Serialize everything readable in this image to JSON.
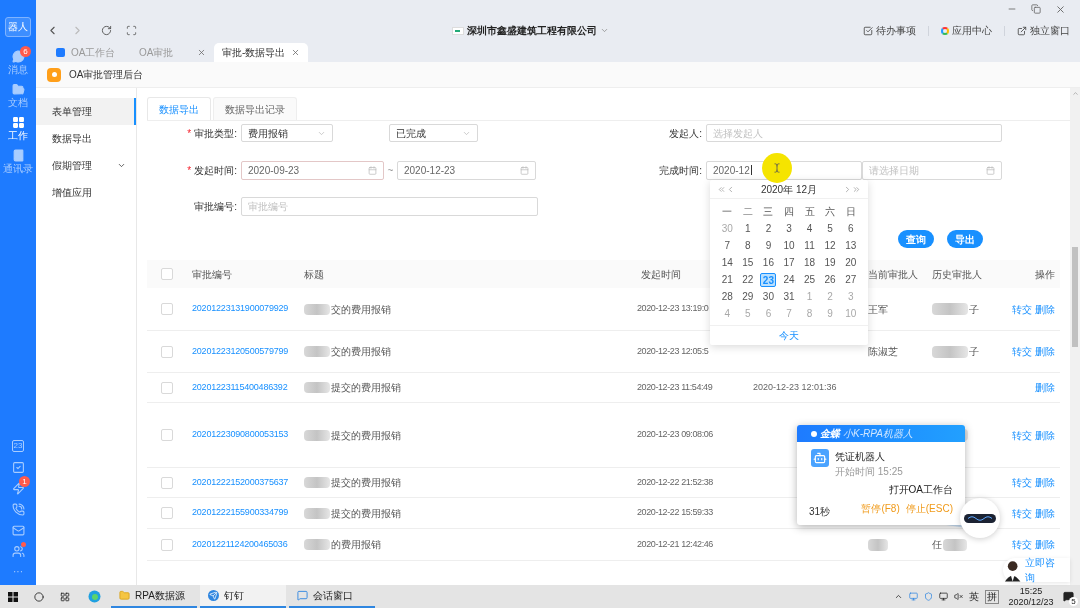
{
  "rail": {
    "logo": "器人",
    "items": [
      {
        "label": "消息",
        "kind": "chat",
        "badge": "6",
        "selected": false
      },
      {
        "label": "文档",
        "kind": "docs",
        "selected": false
      },
      {
        "label": "工作",
        "kind": "work",
        "selected": true
      },
      {
        "label": "通讯录",
        "kind": "contacts",
        "selected": false
      }
    ],
    "bottom": [
      {
        "kind": "calendar",
        "label": "23",
        "dot": false
      },
      {
        "kind": "todo",
        "dot": false
      },
      {
        "kind": "ding",
        "badge": "1",
        "dot": false
      },
      {
        "kind": "phone",
        "dot": false
      },
      {
        "kind": "mail",
        "dot": false
      },
      {
        "kind": "team",
        "dot": true
      },
      {
        "kind": "more",
        "label": "···",
        "dot": false
      }
    ]
  },
  "toolbar": {
    "company": "深圳市鑫盛建筑工程有限公司",
    "actions": [
      {
        "label": "待办事项",
        "kind": "todo"
      },
      {
        "label": "应用中心",
        "kind": "apps"
      },
      {
        "label": "独立窗口",
        "kind": "window"
      }
    ]
  },
  "tabs": [
    {
      "label": "OA工作台",
      "kind": "app",
      "closable": false,
      "selected": false
    },
    {
      "label": "OA审批",
      "kind": "page",
      "closable": true,
      "selected": false
    },
    {
      "label": "审批-数据导出",
      "kind": "page",
      "closable": true,
      "selected": true
    }
  ],
  "app_header": {
    "title": "OA审批管理后台"
  },
  "menu": [
    {
      "label": "表单管理",
      "expandable": false,
      "selected": true
    },
    {
      "label": "数据导出",
      "expandable": false,
      "selected": false
    },
    {
      "label": "假期管理",
      "expandable": true,
      "selected": false
    },
    {
      "label": "增值应用",
      "expandable": false,
      "selected": false
    }
  ],
  "content_tabs": [
    {
      "label": "数据导出",
      "selected": true
    },
    {
      "label": "数据导出记录",
      "selected": false
    }
  ],
  "form": {
    "approval_type": {
      "mark": "*",
      "label": "审批类型:",
      "value": "费用报销"
    },
    "status": {
      "value": "已完成"
    },
    "initiator": {
      "label": "发起人:",
      "placeholder": "选择发起人"
    },
    "start_time": {
      "mark": "*",
      "label": "发起时间:",
      "from": "2020-09-23",
      "separator": "~",
      "to": "2020-12-23"
    },
    "finish_time": {
      "label": "完成时间:",
      "from": "2020-12",
      "to_placeholder": "请选择日期"
    },
    "approval_no": {
      "label": "审批编号:",
      "placeholder": "审批编号"
    },
    "buttons": [
      "查询",
      "导出"
    ]
  },
  "calendar": {
    "title": "2020年 12月",
    "weekdays": [
      "一",
      "二",
      "三",
      "四",
      "五",
      "六",
      "日"
    ],
    "days": [
      {
        "label": "30",
        "outside": true,
        "selected": false
      },
      {
        "label": "1",
        "outside": false,
        "selected": false
      },
      {
        "label": "2",
        "outside": false,
        "selected": false
      },
      {
        "label": "3",
        "outside": false,
        "selected": false
      },
      {
        "label": "4",
        "outside": false,
        "selected": false
      },
      {
        "label": "5",
        "outside": false,
        "selected": false
      },
      {
        "label": "6",
        "outside": false,
        "selected": false
      },
      {
        "label": "7",
        "outside": false,
        "selected": false
      },
      {
        "label": "8",
        "outside": false,
        "selected": false
      },
      {
        "label": "9",
        "outside": false,
        "selected": false
      },
      {
        "label": "10",
        "outside": false,
        "selected": false
      },
      {
        "label": "11",
        "outside": false,
        "selected": false
      },
      {
        "label": "12",
        "outside": false,
        "selected": false
      },
      {
        "label": "13",
        "outside": false,
        "selected": false
      },
      {
        "label": "14",
        "outside": false,
        "selected": false
      },
      {
        "label": "15",
        "outside": false,
        "selected": false
      },
      {
        "label": "16",
        "outside": false,
        "selected": false
      },
      {
        "label": "17",
        "outside": false,
        "selected": false
      },
      {
        "label": "18",
        "outside": false,
        "selected": false
      },
      {
        "label": "19",
        "outside": false,
        "selected": false
      },
      {
        "label": "20",
        "outside": false,
        "selected": false
      },
      {
        "label": "21",
        "outside": false,
        "selected": false
      },
      {
        "label": "22",
        "outside": false,
        "selected": false
      },
      {
        "label": "23",
        "outside": false,
        "selected": true
      },
      {
        "label": "24",
        "outside": false,
        "selected": false
      },
      {
        "label": "25",
        "outside": false,
        "selected": false
      },
      {
        "label": "26",
        "outside": false,
        "selected": false
      },
      {
        "label": "27",
        "outside": false,
        "selected": false
      },
      {
        "label": "28",
        "outside": false,
        "selected": false
      },
      {
        "label": "29",
        "outside": false,
        "selected": false
      },
      {
        "label": "30",
        "outside": false,
        "selected": false
      },
      {
        "label": "31",
        "outside": false,
        "selected": false
      },
      {
        "label": "1",
        "outside": true,
        "selected": false
      },
      {
        "label": "2",
        "outside": true,
        "selected": false
      },
      {
        "label": "3",
        "outside": true,
        "selected": false
      },
      {
        "label": "4",
        "outside": true,
        "selected": false
      },
      {
        "label": "5",
        "outside": true,
        "selected": false
      },
      {
        "label": "6",
        "outside": true,
        "selected": false
      },
      {
        "label": "7",
        "outside": true,
        "selected": false
      },
      {
        "label": "8",
        "outside": true,
        "selected": false
      },
      {
        "label": "9",
        "outside": true,
        "selected": false
      },
      {
        "label": "10",
        "outside": true,
        "selected": false
      }
    ],
    "today": "今天"
  },
  "table": {
    "header": {
      "checked": false,
      "number": "审批编号",
      "title": "标题",
      "started": "发起时间",
      "current": "当前审批人",
      "history": "历史审批人",
      "actions": "操作"
    },
    "rows": [
      {
        "checked": false,
        "number": "20201223131900079929",
        "title": "交的费用报销",
        "started": "2020-12-23 13:19:0",
        "current": "王军",
        "history": {
          "after": "子",
          "blurred": true
        },
        "actions": [
          "转交",
          "删除"
        ]
      },
      {
        "checked": false,
        "number": "20201223120500579799",
        "title": "交的费用报销",
        "started": "2020-12-23 12:05:5",
        "current": "陈淑芝",
        "history": {
          "after": "子",
          "blurred": true
        },
        "actions": [
          "转交",
          "删除"
        ]
      },
      {
        "checked": false,
        "number": "20201223115400486392",
        "title": "提交的费用报销",
        "started": "2020-12-23 11:54:49",
        "finished": "2020-12-23 12:01:36",
        "actions": [
          "删除"
        ]
      },
      {
        "checked": false,
        "number": "20201223090800053153",
        "title": "提交的费用报销",
        "started": "2020-12-23 09:08:06",
        "history": {
          "blurred": true
        },
        "actions": [
          "转交",
          "删除"
        ]
      },
      {
        "checked": false,
        "number": "20201222152000375637",
        "title": "提交的费用报销",
        "started": "2020-12-22 21:52:38",
        "actions": [
          "转交",
          "删除"
        ]
      },
      {
        "checked": false,
        "number": "20201222155900334799",
        "title": "提交的费用报销",
        "started": "2020-12-22 15:59:33",
        "actions": [
          "转交",
          "删除"
        ]
      },
      {
        "checked": false,
        "number": "20201221124200465036",
        "title": "的费用报销",
        "started": "2020-12-21 12:42:46",
        "current_blurred": true,
        "history": {
          "before": "任",
          "blurred": true
        },
        "actions": [
          "转交",
          "删除"
        ]
      }
    ]
  },
  "rpa": {
    "brand": "金蝶",
    "product": "小K-RPA机器人",
    "task": "凭证机器人",
    "start": "开始时间 15:25",
    "step": "打开OA工作台",
    "elapsed": "31秒",
    "pause": "暂停(F8)",
    "stop": "停止(ESC)"
  },
  "consult": {
    "label": "立即咨询"
  },
  "taskbar": {
    "apps": [
      {
        "label": "RPA数据源",
        "kind": "folder",
        "active": false
      },
      {
        "label": "钉钉",
        "kind": "dingtalk",
        "active": true
      },
      {
        "label": "会话窗口",
        "kind": "chat",
        "active": false
      }
    ],
    "tray": {
      "lang": "英",
      "ime": "拼",
      "time": "15:25",
      "date": "2020/12/23",
      "notifications": "5"
    }
  }
}
